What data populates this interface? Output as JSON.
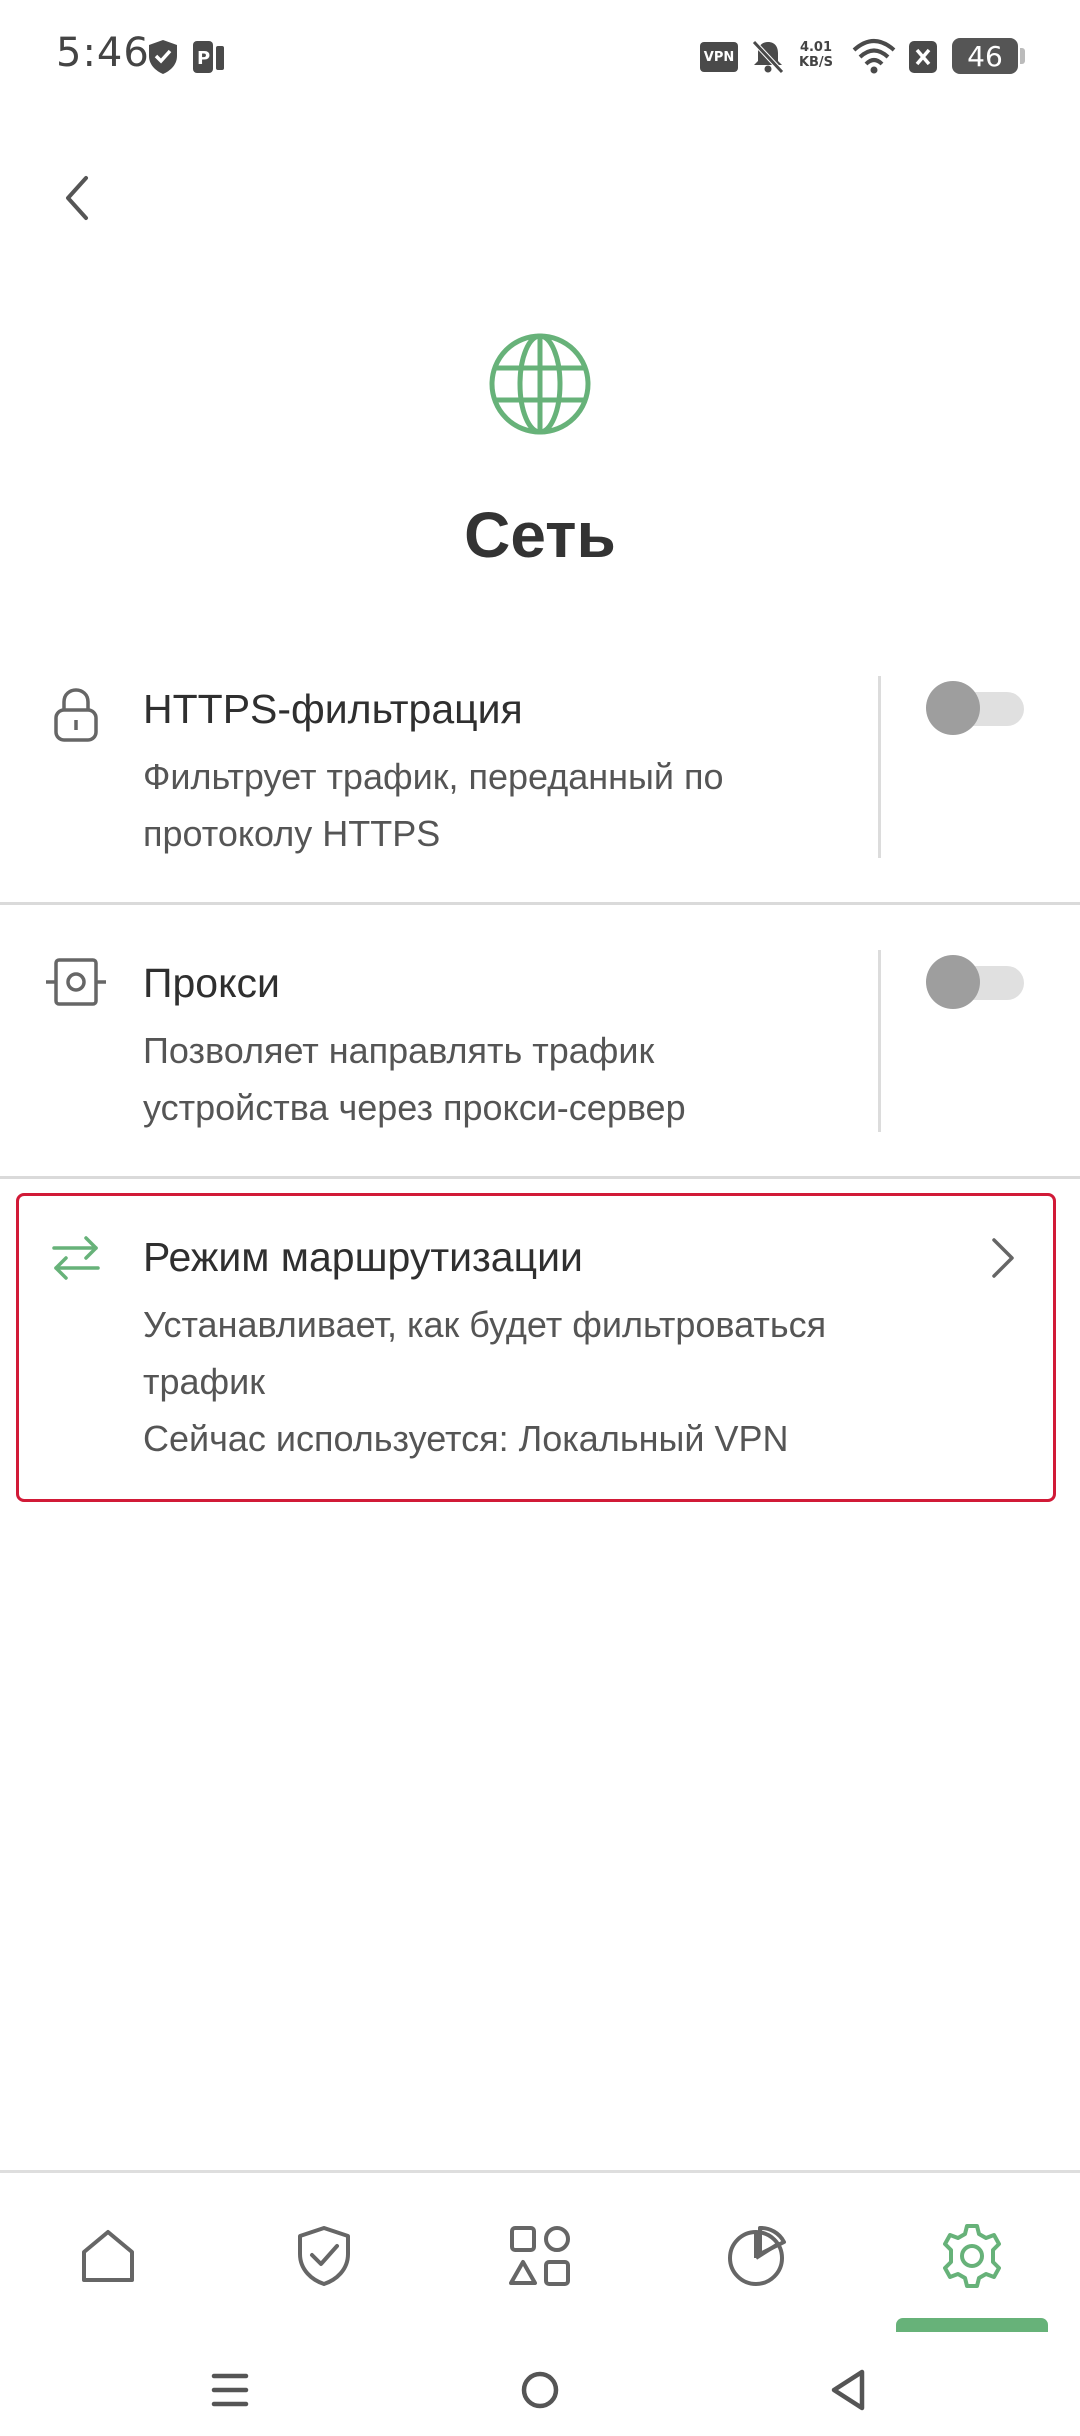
{
  "status_bar": {
    "time": "5:46",
    "vpn_badge": "VPN",
    "speed_value": "4.01",
    "speed_unit": "KB/S",
    "battery": "46"
  },
  "page": {
    "title": "Сеть",
    "accent_color": "#67b279",
    "highlight_color": "#d11a37"
  },
  "settings": [
    {
      "title": "HTTPS-фильтрация",
      "desc_line1": "Фильтрует трафик, переданный по",
      "desc_line2": "протоколу HTTPS",
      "icon": "lock-icon",
      "toggle_on": false
    },
    {
      "title": "Прокси",
      "desc_line1": "Позволяет направлять трафик",
      "desc_line2": "устройства через прокси-сервер",
      "icon": "proxy-icon",
      "toggle_on": false
    },
    {
      "title": "Режим маршрутизации",
      "desc_line1": "Устанавливает, как будет фильтроваться",
      "desc_line2": "трафик",
      "desc_line3": "Сейчас используется: Локальный VPN",
      "icon": "swap-arrows-icon"
    }
  ],
  "bottom_nav": [
    {
      "icon": "home-icon",
      "active": false
    },
    {
      "icon": "shield-check-icon",
      "active": false
    },
    {
      "icon": "apps-icon",
      "active": false
    },
    {
      "icon": "stats-pie-icon",
      "active": false
    },
    {
      "icon": "gear-icon",
      "active": true
    }
  ]
}
